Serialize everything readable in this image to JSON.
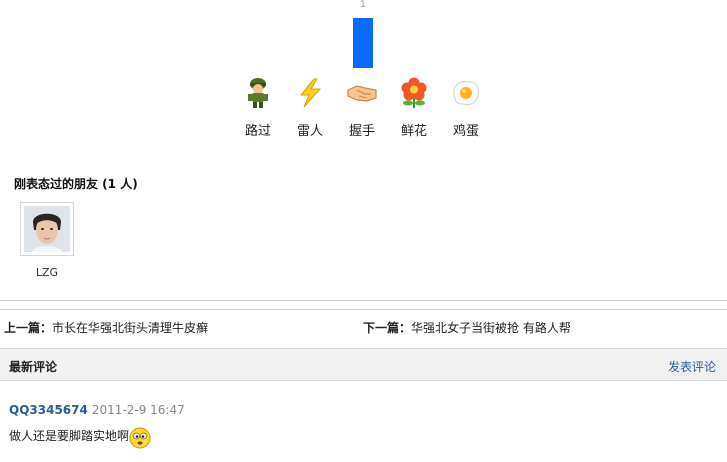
{
  "vote": {
    "count": "1"
  },
  "reactions": [
    {
      "label": "路过",
      "icon": "soldier-icon"
    },
    {
      "label": "雷人",
      "icon": "lightning-icon"
    },
    {
      "label": "握手",
      "icon": "handshake-icon"
    },
    {
      "label": "鲜花",
      "icon": "flower-icon"
    },
    {
      "label": "鸡蛋",
      "icon": "egg-icon"
    }
  ],
  "friends": {
    "title": "刚表态过的朋友 (1 人)",
    "items": [
      {
        "name": "LZG"
      }
    ]
  },
  "nav": {
    "prev_label": "上一篇：",
    "prev_title": "市长在华强北街头清理牛皮癣",
    "next_label": "下一篇：",
    "next_title": "华强北女子当街被抢 有路人帮"
  },
  "comments": {
    "title": "最新评论",
    "post_link": "发表评论",
    "items": [
      {
        "user": "QQ3345674",
        "time": "2011-2-9 16:47",
        "text": "做人还是要脚踏实地啊"
      }
    ]
  },
  "colors": {
    "bar": "#0a6cf5",
    "link": "#2a5d95"
  }
}
